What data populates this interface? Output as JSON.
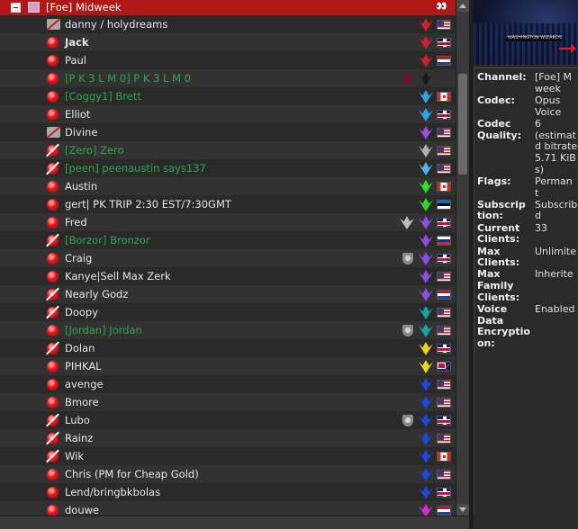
{
  "channel": {
    "name": "[Foe] Midweek",
    "flag_glyph": "👀"
  },
  "clients": [
    {
      "name": "danny / holydreams",
      "status": "muted",
      "badge_color": "#cc1f2b",
      "flag": "us",
      "color": "white"
    },
    {
      "name": "Jack",
      "status": "dot",
      "badge_color": "#cc1f2b",
      "flag": "gb",
      "color": "white",
      "bold": true
    },
    {
      "name": "Paul",
      "status": "dot",
      "badge_color": "#cc1f2b",
      "flag": "nl",
      "color": "white"
    },
    {
      "name": "[P K 3 L M 0] P K 3 L M 0",
      "status": "dot",
      "badge_color": "#1a1a1a",
      "badge2": "rank2",
      "flag": "",
      "color": "green"
    },
    {
      "name": "[Coggy1] Brett",
      "status": "dot",
      "badge_color": "#2fa6e8",
      "flag": "ca",
      "color": "green"
    },
    {
      "name": "Elliot",
      "status": "dot",
      "badge_color": "#2fa6e8",
      "flag": "gb",
      "color": "white"
    },
    {
      "name": "Divine",
      "status": "muted",
      "badge_color": "#9a4de0",
      "flag": "us",
      "color": "white"
    },
    {
      "name": "[Zero] Zero",
      "status": "nomic",
      "badge_color": "#b0b0b0",
      "flag": "us",
      "color": "green"
    },
    {
      "name": "[peen] peenaustin says137",
      "status": "nomic",
      "badge_color": "#5aaee8",
      "flag": "us",
      "color": "green"
    },
    {
      "name": "Austin",
      "status": "dot",
      "badge_color": "#2edb2e",
      "flag": "ca",
      "color": "white"
    },
    {
      "name": "gert| PK TRIP 2:30 EST/7:30GMT",
      "status": "dot",
      "badge_color": "#2edb2e",
      "flag": "ee",
      "color": "white"
    },
    {
      "name": "Fred",
      "status": "dot",
      "badge_color": "#8a4de0",
      "badge2": "grey",
      "flag": "gb",
      "color": "white"
    },
    {
      "name": "[Borzor] Bronzor",
      "status": "nomic",
      "badge_color": "#8a4de0",
      "flag": "ru",
      "color": "green"
    },
    {
      "name": "Craig",
      "status": "dot",
      "badge_color": "#8a4de0",
      "badge2": "shield",
      "flag": "gb",
      "color": "white"
    },
    {
      "name": "Kanye|Sell Max Zerk",
      "status": "dot",
      "badge_color": "#8a4de0",
      "flag": "us",
      "color": "white"
    },
    {
      "name": "Nearly Godz",
      "status": "nomic",
      "badge_color": "#8a4de0",
      "flag": "nl",
      "color": "white"
    },
    {
      "name": "Doopy",
      "status": "nomic",
      "badge_color": "#15a8a0",
      "flag": "us",
      "color": "white"
    },
    {
      "name": "[Jordan] Jordan",
      "status": "dot",
      "badge_color": "#15a8a0",
      "badge2": "shield",
      "flag": "us",
      "color": "green"
    },
    {
      "name": "Dolan",
      "status": "nomic",
      "badge_color": "#e6d51f",
      "flag": "gb",
      "color": "white"
    },
    {
      "name": "PIHKAL",
      "status": "dot",
      "badge_color": "#e6d51f",
      "flag": "nz",
      "color": "white"
    },
    {
      "name": "avenge",
      "status": "dot",
      "badge_color": "#1f45d6",
      "flag": "us",
      "color": "white"
    },
    {
      "name": "Bmore",
      "status": "dot",
      "badge_color": "#1f45d6",
      "flag": "us",
      "color": "white"
    },
    {
      "name": "Lubo",
      "status": "nomic",
      "badge_color": "#1f45d6",
      "badge2": "shield",
      "flag": "gb",
      "color": "white"
    },
    {
      "name": "Rainz",
      "status": "nomic",
      "badge_color": "#1f45d6",
      "flag": "us",
      "color": "white"
    },
    {
      "name": "Wik",
      "status": "nomic",
      "badge_color": "#1f45d6",
      "flag": "ca",
      "color": "white"
    },
    {
      "name": "Chris (PM for Cheap Gold)",
      "status": "dot",
      "badge_color": "#1f45d6",
      "flag": "us",
      "color": "white"
    },
    {
      "name": "Lend/bringbkbolas",
      "status": "dot",
      "badge_color": "#1f45d6",
      "flag": "gb",
      "color": "white"
    },
    {
      "name": "douwe",
      "status": "dot",
      "badge_color": "#d12bd1",
      "flag": "nl",
      "color": "white"
    }
  ],
  "info": {
    "rows": [
      {
        "label": "Channel:",
        "value": "[Foe] M\nweek"
      },
      {
        "label": "Codec:",
        "value": "Opus\nVoice"
      },
      {
        "label": "Codec\nQuality:",
        "value": "6\n(estimat\nd bitrate\n5.71 KiB\ns)"
      },
      {
        "label": "Flags:",
        "value": "Perman\nt"
      },
      {
        "label": "Subscrip\ntion:",
        "value": "Subscrib\nd"
      },
      {
        "label": "Current\nClients:",
        "value": "33"
      },
      {
        "label": "Max\nClients:",
        "value": "Unlimite"
      },
      {
        "label": "Max\nFamily\nClients:",
        "value": "Inherite"
      },
      {
        "label": "Voice\nData\nEncryptio\non:",
        "value": "Enabled"
      }
    ]
  },
  "banner": {
    "text": "WASHINGTON WIZARDS"
  },
  "colors": {
    "channel_bar": "#b01818",
    "nickname_green": "#2da84a",
    "background": "#2a2a2a"
  }
}
